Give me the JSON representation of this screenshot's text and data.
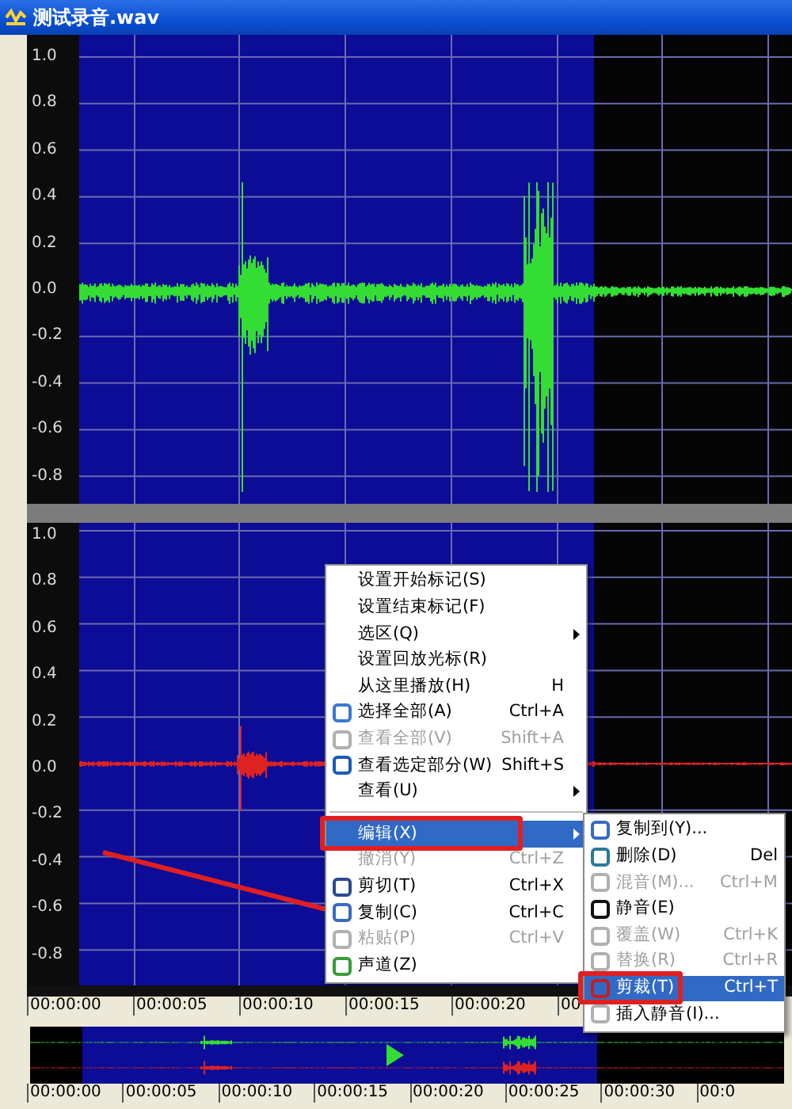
{
  "window": {
    "title": "测试录音.wav"
  },
  "channels": [
    {
      "color": "#33dd33",
      "axis_labels": [
        "1.0",
        "0.8",
        "0.6",
        "0.4",
        "0.2",
        "0.0",
        "-0.2",
        "-0.4",
        "-0.6",
        "-0.8"
      ]
    },
    {
      "color": "#dd2222",
      "axis_labels": [
        "1.0",
        "0.8",
        "0.6",
        "0.4",
        "0.2",
        "0.0",
        "-0.2",
        "-0.4",
        "-0.6",
        "-0.8"
      ]
    }
  ],
  "timeline": {
    "ticks": [
      "00:00:00",
      "00:00:05",
      "00:00:10",
      "00:00:15",
      "00:00:20",
      "00"
    ]
  },
  "overview": {
    "ticks": [
      "00:00:00",
      "00:00:05",
      "00:00:10",
      "00:00:15",
      "00:00:20",
      "00:00:25",
      "00:00:30",
      "00:0"
    ]
  },
  "context_menu": {
    "items": [
      {
        "label": "设置开始标记(S)",
        "submenu": false,
        "disabled": false,
        "selected": false
      },
      {
        "label": "设置结束标记(F)",
        "submenu": false,
        "disabled": false,
        "selected": false
      },
      {
        "label": "选区(Q)",
        "submenu": true,
        "disabled": false,
        "selected": false
      },
      {
        "label": "设置回放光标(R)",
        "submenu": false,
        "disabled": false,
        "selected": false
      },
      {
        "label": "从这里播放(H)",
        "shortcut": "H",
        "submenu": false,
        "disabled": false,
        "selected": false
      },
      {
        "label": "选择全部(A)",
        "shortcut": "Ctrl+A",
        "submenu": false,
        "disabled": false,
        "selected": false
      },
      {
        "label": "查看全部(V)",
        "shortcut": "Shift+A",
        "submenu": false,
        "disabled": true,
        "selected": false
      },
      {
        "label": "查看选定部分(W)",
        "shortcut": "Shift+S",
        "submenu": false,
        "disabled": false,
        "selected": false
      },
      {
        "label": "查看(U)",
        "submenu": true,
        "disabled": false,
        "selected": false
      },
      {
        "label": "编辑(X)",
        "submenu": true,
        "disabled": false,
        "selected": true
      },
      {
        "label": "撤消(Y)",
        "shortcut": "Ctrl+Z",
        "submenu": false,
        "disabled": true,
        "selected": false
      },
      {
        "label": "剪切(T)",
        "shortcut": "Ctrl+X",
        "submenu": false,
        "disabled": false,
        "selected": false
      },
      {
        "label": "复制(C)",
        "shortcut": "Ctrl+C",
        "submenu": false,
        "disabled": false,
        "selected": false
      },
      {
        "label": "粘贴(P)",
        "shortcut": "Ctrl+V",
        "submenu": false,
        "disabled": true,
        "selected": false
      },
      {
        "label": "声道(Z)",
        "submenu": false,
        "disabled": false,
        "selected": false
      }
    ]
  },
  "submenu": {
    "items": [
      {
        "label": "复制到(Y)...",
        "disabled": false,
        "selected": false
      },
      {
        "label": "删除(D)",
        "shortcut": "Del",
        "disabled": false,
        "selected": false
      },
      {
        "label": "混音(M)...",
        "shortcut": "Ctrl+M",
        "disabled": true,
        "selected": false
      },
      {
        "label": "静音(E)",
        "disabled": false,
        "selected": false
      },
      {
        "label": "覆盖(W)",
        "shortcut": "Ctrl+K",
        "disabled": true,
        "selected": false
      },
      {
        "label": "替换(R)",
        "shortcut": "Ctrl+R",
        "disabled": true,
        "selected": false
      },
      {
        "label": "剪裁(T)",
        "shortcut": "Ctrl+T",
        "disabled": false,
        "selected": true
      },
      {
        "label": "插入静音(I)...",
        "disabled": false,
        "selected": false
      }
    ]
  }
}
